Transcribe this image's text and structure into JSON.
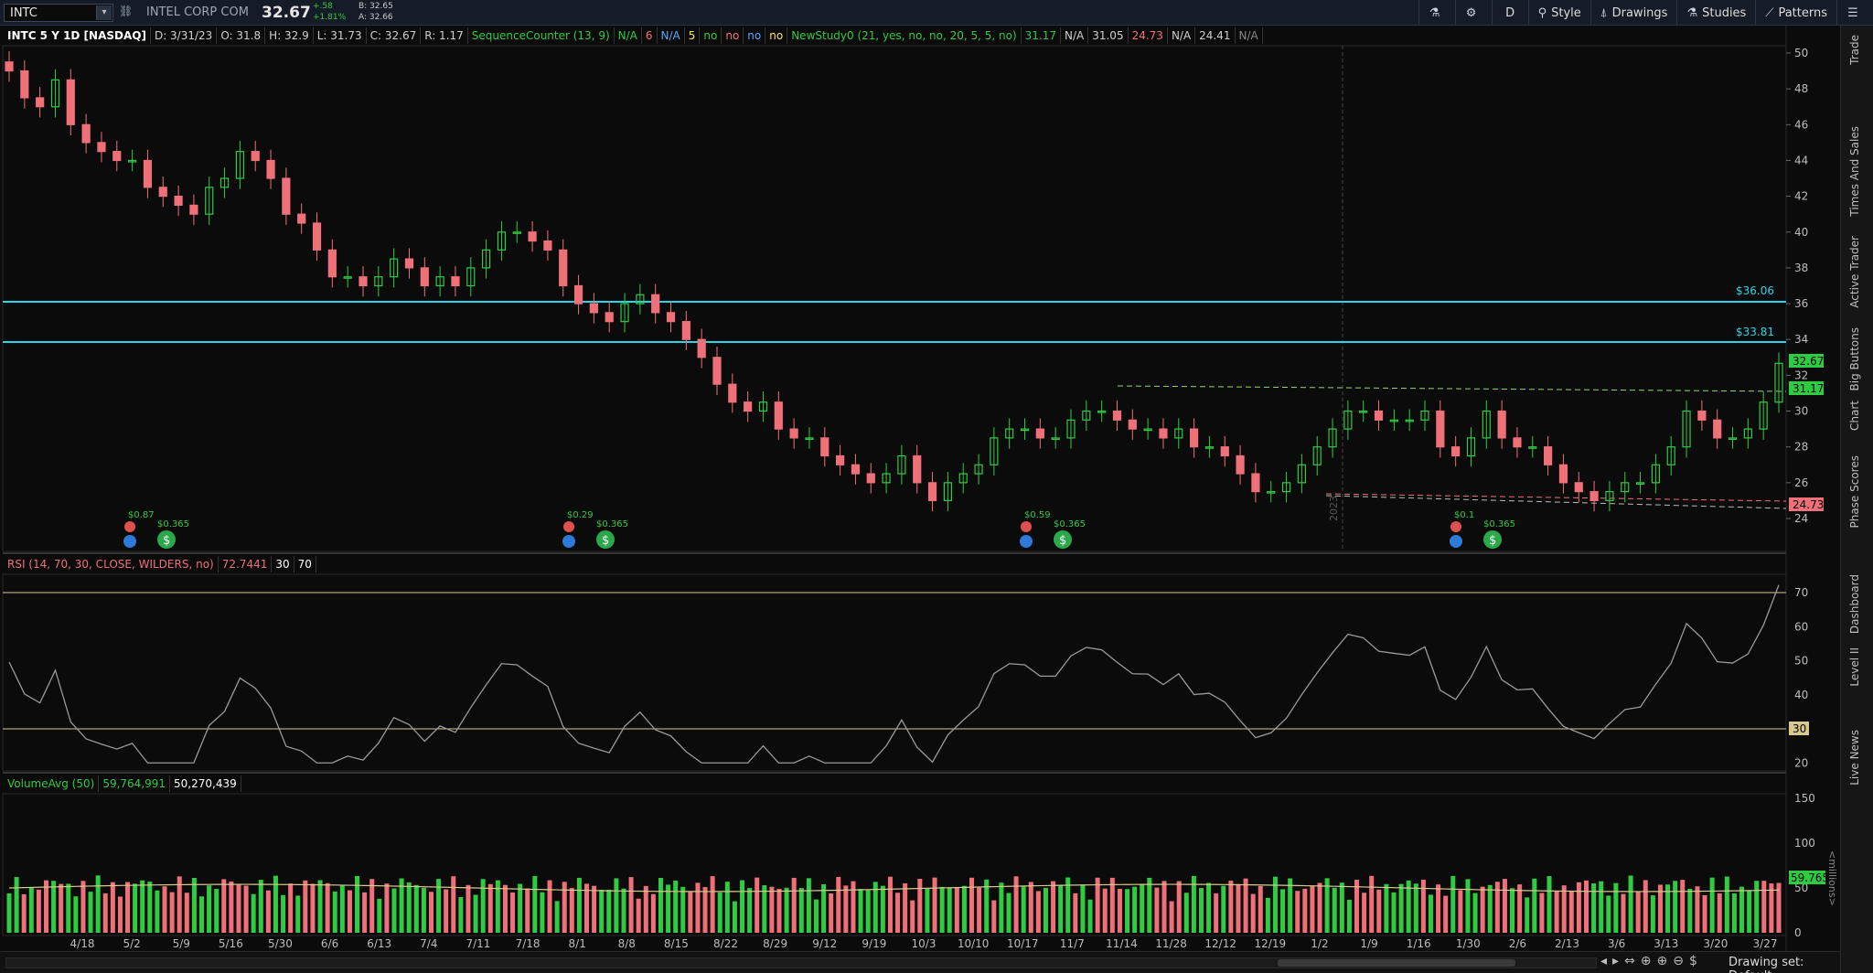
{
  "header": {
    "symbol": "INTC",
    "company": "INTEL CORP COM",
    "last": "32.67",
    "change": "+.58",
    "change_pct": "+1.81%",
    "bid": "B: 32.65",
    "ask": "A: 32.66"
  },
  "toolbar": {
    "flask_label": "",
    "gear_label": "",
    "period_label": "D",
    "style_label": "Style",
    "drawings_label": "Drawings",
    "studies_label": "Studies",
    "patterns_label": "Patterns",
    "menu_label": ""
  },
  "studybar": {
    "title": "INTC 5 Y 1D [NASDAQ]",
    "date": "D: 3/31/23",
    "open": "O: 31.8",
    "high": "H: 32.9",
    "low": "L: 31.73",
    "close": "C: 32.67",
    "range": "R: 1.17",
    "seq_label": "SequenceCounter (13, 9)",
    "seq_v1": "N/A",
    "seq_v2": "6",
    "seq_v3": "N/A",
    "seq_v4": "5",
    "seq_v5": "no",
    "seq_v6": "no",
    "seq_v7": "no",
    "seq_v8": "no",
    "ns_label": "NewStudy0 (21, yes, no, no, 20, 5, 5, no)",
    "ns_v1": "31.17",
    "ns_v2": "N/A",
    "ns_v3": "31.05",
    "ns_v4": "24.73",
    "ns_v5": "N/A",
    "ns_v6": "24.41",
    "ns_v7": "N/A"
  },
  "rsibar": {
    "label": "RSI (14, 70, 30, CLOSE, WILDERS, no)",
    "value": "72.7441",
    "low": "30",
    "high": "70"
  },
  "volbar": {
    "label": "VolumeAvg (50)",
    "volume": "59,764,991",
    "avg": "50,270,439"
  },
  "price_axis": [
    "50",
    "48",
    "46",
    "44",
    "42",
    "40",
    "38",
    "36",
    "34",
    "32",
    "30",
    "28",
    "26",
    "24"
  ],
  "rsi_axis": [
    "70",
    "60",
    "50",
    "40",
    "30",
    "20"
  ],
  "vol_axis": [
    "150",
    "100",
    "50",
    "0"
  ],
  "vol_unit": "<millions>",
  "date_axis": [
    "4/18",
    "5/2",
    "5/9",
    "5/16",
    "5/30",
    "6/6",
    "6/13",
    "7/4",
    "7/11",
    "7/18",
    "8/1",
    "8/8",
    "8/15",
    "8/22",
    "8/29",
    "9/12",
    "9/19",
    "10/3",
    "10/10",
    "10/17",
    "11/7",
    "11/14",
    "11/28",
    "12/12",
    "12/19",
    "1/2",
    "1/9",
    "1/16",
    "1/30",
    "2/6",
    "2/13",
    "3/6",
    "3/13",
    "3/20",
    "3/27"
  ],
  "year_marker": "2023",
  "levels": {
    "upper": "$36.06",
    "lower": "$33.81",
    "last_tag": "32.67",
    "study_tag": "31.17",
    "support_tag": "24.73",
    "rsi_30_tag": "30",
    "vol_tag": "59.765"
  },
  "dividends": [
    {
      "amount": "$0.365",
      "event": "$0.87"
    },
    {
      "amount": "$0.365",
      "event": "$0.29"
    },
    {
      "amount": "$0.365",
      "event": "$0.59"
    },
    {
      "amount": "$0.365",
      "event": "$0.1"
    }
  ],
  "right_tabs": [
    "Trade",
    "Times And Sales",
    "Active Trader",
    "Big Buttons",
    "Chart",
    "Phase Scores",
    "Dashboard",
    "Level II",
    "Live News"
  ],
  "bottom": {
    "drawing_set": "Drawing set: Default"
  },
  "colors": {
    "up": "#2ecc40",
    "down": "#f0707a",
    "level": "#29d3e8",
    "rsi_band": "#d8c98c",
    "background": "#0b0b0b"
  },
  "chart_data": {
    "type": "candlestick",
    "closes_approx": [
      49,
      47.5,
      47,
      48.5,
      46,
      45,
      44.5,
      44,
      44,
      42.5,
      42,
      41.5,
      41,
      42.5,
      43,
      44.5,
      44,
      43,
      41,
      40.5,
      39,
      37.5,
      37.5,
      37,
      37.5,
      38.5,
      38,
      37,
      37.5,
      37,
      38,
      39,
      40,
      40,
      39.5,
      39,
      37,
      36,
      35.5,
      35,
      36,
      36.5,
      35.5,
      35,
      34,
      33,
      31.5,
      30.5,
      30,
      30.5,
      29,
      28.5,
      28.5,
      27.5,
      27,
      26.5,
      26,
      26.5,
      27.5,
      26,
      25,
      26,
      26.5,
      27,
      28.5,
      29,
      29,
      28.5,
      28.5,
      29.5,
      30,
      30,
      29.5,
      29,
      29,
      28.5,
      29,
      28,
      28,
      27.5,
      26.5,
      25.5,
      25.5,
      26,
      27,
      28,
      29,
      30,
      30,
      29.5,
      29.5,
      29.5,
      30,
      28,
      27.5,
      28.5,
      30,
      28.5,
      28,
      28,
      27,
      26,
      25.5,
      25,
      25.5,
      26,
      26,
      27,
      28,
      30,
      29.5,
      28.5,
      28.5,
      29,
      30.5,
      32.67
    ]
  }
}
